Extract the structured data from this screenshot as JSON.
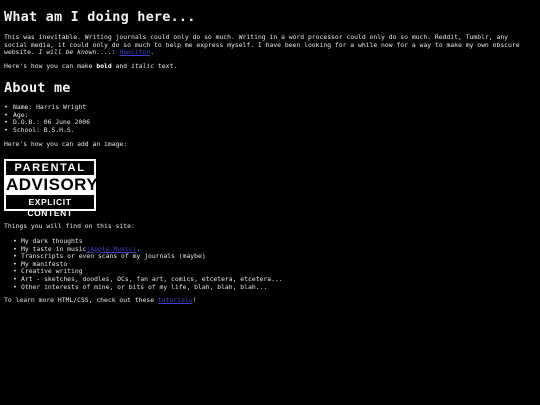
{
  "heading1": "What am I doing here...",
  "intro": {
    "text": "This was inevitable. Writing journals could only do so much. Writing in a word processor could only do so much. Reddit, Tumblr, any social media, it could only do so much to help me express myself. I have been looking for a while now for a way to make my own obscure website. ",
    "italic": "I will be known....",
    "colon": ": ",
    "link": "Hamilton",
    "end": "."
  },
  "format_line": {
    "prefix": "Here's how you can make ",
    "bold": "bold",
    "middle": " and ",
    "italic": "italic",
    "suffix": " text."
  },
  "heading2": "About me",
  "about": [
    "Name: Harris Wright",
    "Age: ",
    "D.O.B.: 06 June 2006",
    "School: B.S.H.S."
  ],
  "image_line": "Here's how you can add an image:",
  "image": {
    "line1": "PARENTAL",
    "line2": "ADVISORY",
    "line3": "EXPLICIT CONTENT"
  },
  "things_line": "Things you will find on this site:",
  "things": {
    "item1": "My dark thoughts",
    "item2_prefix": "My taste in music",
    "item2_link": "(Apple Music)",
    "item2_suffix": ".",
    "item3": "Transcripts or even scans of my journals (maybe)",
    "item4": "My manifesto",
    "item5": "Creative writing",
    "item6": "Art - sketches, doodles, OCs, fan art, comics, etcetera, etcetera...",
    "item7": "Other interests of mine, or bits of my life, blah, blah, blah..."
  },
  "learn": {
    "prefix": "To learn more HTML/CSS, check out these ",
    "link": "tutorials",
    "suffix": "!"
  },
  "colors": {
    "background": "#000000",
    "text": "#e8e8e8",
    "link": "#4040c8"
  }
}
